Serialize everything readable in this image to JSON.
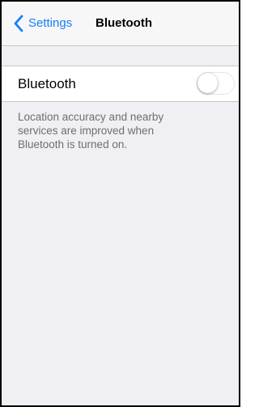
{
  "navbar": {
    "back_label": "Settings",
    "title": "Bluetooth",
    "back_icon": "chevron-left-icon"
  },
  "bluetooth_cell": {
    "label": "Bluetooth",
    "toggle_on": false
  },
  "footer": {
    "lines": [
      "Location accuracy and nearby",
      "services are improved when",
      "Bluetooth is turned on."
    ]
  },
  "colors": {
    "accent": "#157efb",
    "background": "#efeff4",
    "separator": "#c8c7cc",
    "footer_text": "#6d6d72"
  }
}
